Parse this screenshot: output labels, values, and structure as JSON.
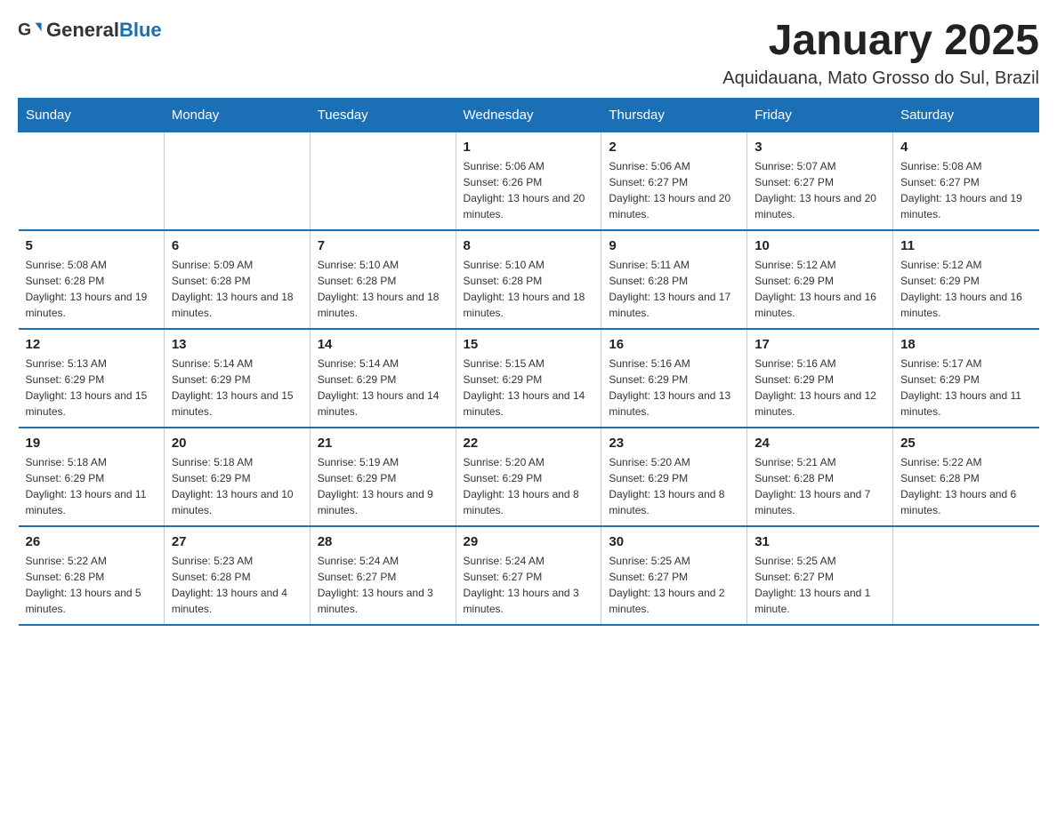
{
  "header": {
    "logo": {
      "general": "General",
      "blue": "Blue"
    },
    "title": "January 2025",
    "location": "Aquidauana, Mato Grosso do Sul, Brazil"
  },
  "weekdays": [
    "Sunday",
    "Monday",
    "Tuesday",
    "Wednesday",
    "Thursday",
    "Friday",
    "Saturday"
  ],
  "weeks": [
    [
      {
        "day": "",
        "info": ""
      },
      {
        "day": "",
        "info": ""
      },
      {
        "day": "",
        "info": ""
      },
      {
        "day": "1",
        "info": "Sunrise: 5:06 AM\nSunset: 6:26 PM\nDaylight: 13 hours and 20 minutes."
      },
      {
        "day": "2",
        "info": "Sunrise: 5:06 AM\nSunset: 6:27 PM\nDaylight: 13 hours and 20 minutes."
      },
      {
        "day": "3",
        "info": "Sunrise: 5:07 AM\nSunset: 6:27 PM\nDaylight: 13 hours and 20 minutes."
      },
      {
        "day": "4",
        "info": "Sunrise: 5:08 AM\nSunset: 6:27 PM\nDaylight: 13 hours and 19 minutes."
      }
    ],
    [
      {
        "day": "5",
        "info": "Sunrise: 5:08 AM\nSunset: 6:28 PM\nDaylight: 13 hours and 19 minutes."
      },
      {
        "day": "6",
        "info": "Sunrise: 5:09 AM\nSunset: 6:28 PM\nDaylight: 13 hours and 18 minutes."
      },
      {
        "day": "7",
        "info": "Sunrise: 5:10 AM\nSunset: 6:28 PM\nDaylight: 13 hours and 18 minutes."
      },
      {
        "day": "8",
        "info": "Sunrise: 5:10 AM\nSunset: 6:28 PM\nDaylight: 13 hours and 18 minutes."
      },
      {
        "day": "9",
        "info": "Sunrise: 5:11 AM\nSunset: 6:28 PM\nDaylight: 13 hours and 17 minutes."
      },
      {
        "day": "10",
        "info": "Sunrise: 5:12 AM\nSunset: 6:29 PM\nDaylight: 13 hours and 16 minutes."
      },
      {
        "day": "11",
        "info": "Sunrise: 5:12 AM\nSunset: 6:29 PM\nDaylight: 13 hours and 16 minutes."
      }
    ],
    [
      {
        "day": "12",
        "info": "Sunrise: 5:13 AM\nSunset: 6:29 PM\nDaylight: 13 hours and 15 minutes."
      },
      {
        "day": "13",
        "info": "Sunrise: 5:14 AM\nSunset: 6:29 PM\nDaylight: 13 hours and 15 minutes."
      },
      {
        "day": "14",
        "info": "Sunrise: 5:14 AM\nSunset: 6:29 PM\nDaylight: 13 hours and 14 minutes."
      },
      {
        "day": "15",
        "info": "Sunrise: 5:15 AM\nSunset: 6:29 PM\nDaylight: 13 hours and 14 minutes."
      },
      {
        "day": "16",
        "info": "Sunrise: 5:16 AM\nSunset: 6:29 PM\nDaylight: 13 hours and 13 minutes."
      },
      {
        "day": "17",
        "info": "Sunrise: 5:16 AM\nSunset: 6:29 PM\nDaylight: 13 hours and 12 minutes."
      },
      {
        "day": "18",
        "info": "Sunrise: 5:17 AM\nSunset: 6:29 PM\nDaylight: 13 hours and 11 minutes."
      }
    ],
    [
      {
        "day": "19",
        "info": "Sunrise: 5:18 AM\nSunset: 6:29 PM\nDaylight: 13 hours and 11 minutes."
      },
      {
        "day": "20",
        "info": "Sunrise: 5:18 AM\nSunset: 6:29 PM\nDaylight: 13 hours and 10 minutes."
      },
      {
        "day": "21",
        "info": "Sunrise: 5:19 AM\nSunset: 6:29 PM\nDaylight: 13 hours and 9 minutes."
      },
      {
        "day": "22",
        "info": "Sunrise: 5:20 AM\nSunset: 6:29 PM\nDaylight: 13 hours and 8 minutes."
      },
      {
        "day": "23",
        "info": "Sunrise: 5:20 AM\nSunset: 6:29 PM\nDaylight: 13 hours and 8 minutes."
      },
      {
        "day": "24",
        "info": "Sunrise: 5:21 AM\nSunset: 6:28 PM\nDaylight: 13 hours and 7 minutes."
      },
      {
        "day": "25",
        "info": "Sunrise: 5:22 AM\nSunset: 6:28 PM\nDaylight: 13 hours and 6 minutes."
      }
    ],
    [
      {
        "day": "26",
        "info": "Sunrise: 5:22 AM\nSunset: 6:28 PM\nDaylight: 13 hours and 5 minutes."
      },
      {
        "day": "27",
        "info": "Sunrise: 5:23 AM\nSunset: 6:28 PM\nDaylight: 13 hours and 4 minutes."
      },
      {
        "day": "28",
        "info": "Sunrise: 5:24 AM\nSunset: 6:27 PM\nDaylight: 13 hours and 3 minutes."
      },
      {
        "day": "29",
        "info": "Sunrise: 5:24 AM\nSunset: 6:27 PM\nDaylight: 13 hours and 3 minutes."
      },
      {
        "day": "30",
        "info": "Sunrise: 5:25 AM\nSunset: 6:27 PM\nDaylight: 13 hours and 2 minutes."
      },
      {
        "day": "31",
        "info": "Sunrise: 5:25 AM\nSunset: 6:27 PM\nDaylight: 13 hours and 1 minute."
      },
      {
        "day": "",
        "info": ""
      }
    ]
  ]
}
